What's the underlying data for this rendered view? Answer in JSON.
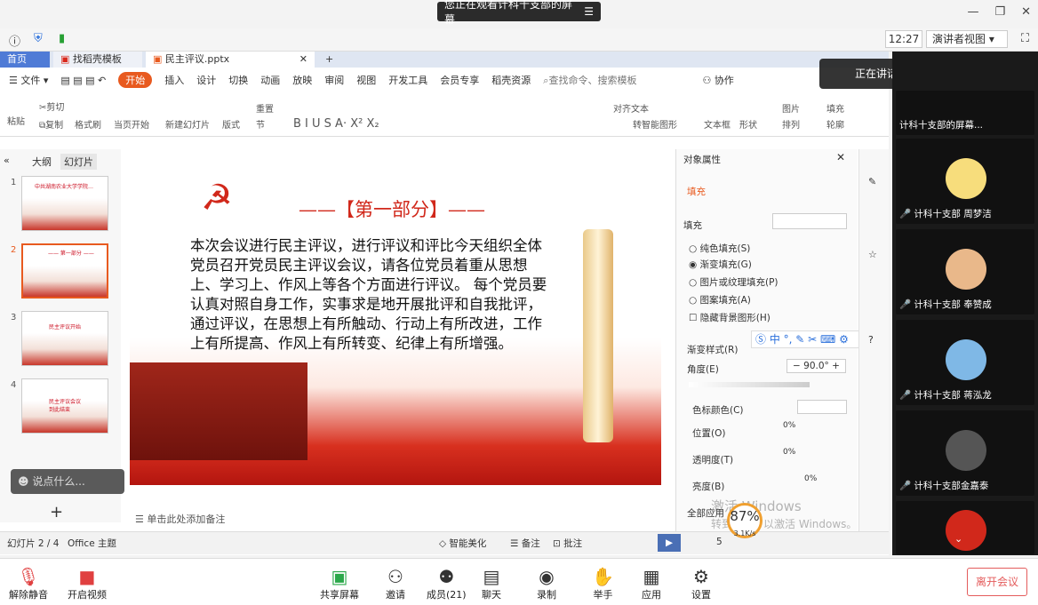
{
  "meeting": {
    "banner": "您正在观看计科十支部的屏幕",
    "clock": "12:27",
    "view_mode": "演讲者视图",
    "speaking": "正在讲话: 计科十支部;"
  },
  "wps": {
    "tabs": [
      "首页",
      "找稻壳模板",
      "民主评议.pptx"
    ],
    "menus": [
      "文件",
      "开始",
      "插入",
      "设计",
      "切换",
      "动画",
      "放映",
      "审阅",
      "视图",
      "开发工具",
      "会员专享",
      "稻壳资源"
    ],
    "search_placeholder": "查找命令、搜索模板",
    "collab": "协作",
    "ribbon": {
      "paste": "粘贴",
      "cut": "剪切",
      "copy": "复制",
      "format_painter": "格式刷",
      "start_from_current": "当页开始",
      "new_slide": "新建幻灯片",
      "layout": "版式",
      "section": "节",
      "reset": "重置",
      "align_text": "对齐文本",
      "smart_shape": "转智能图形",
      "textbox": "文本框",
      "shape": "形状",
      "picture": "图片",
      "fill": "填充",
      "arrange": "排列",
      "outline": "轮廓"
    },
    "left_tabs": [
      "大纲",
      "幻灯片"
    ],
    "slide_numbers": [
      "1",
      "2",
      "3",
      "4"
    ],
    "thumb_texts": [
      "中共湖南农业大学学院…",
      "—— 第一部分 ——",
      "民主评议开始",
      "民主评议会议 到此结束"
    ],
    "slide": {
      "title": "——【第一部分】——",
      "body": "本次会议进行民主评议，进行评议和评比今天组织全体党员召开党员民主评议会议，请各位党员着重从思想上、学习上、作风上等各个方面进行评议。 每个党员要认真对照自身工作，实事求是地开展批评和自我批评，通过评议，在思想上有所触动、行动上有所改进，工作上有所提高、作风上有所转变、纪律上有所增强。"
    },
    "props": {
      "header": "对象属性",
      "tab": "填充",
      "fill_section": "填充",
      "options": [
        "纯色填充(S)",
        "渐变填充(G)",
        "图片或纹理填充(P)",
        "图案填充(A)"
      ],
      "hide_bg": "隐藏背景图形(H)",
      "gradient_style": "渐变样式(R)",
      "angle_label": "角度(E)",
      "angle_value": "90.0°",
      "color_stop": "色标颜色(C)",
      "position": "位置(O)",
      "transparency": "透明度(T)",
      "brightness": "亮度(B)",
      "percent": "0%",
      "apply_all": "全部应用"
    },
    "notes_placeholder": "单击此处添加备注",
    "status": {
      "page": "幻灯片 2 / 4",
      "theme": "Office 主题",
      "smart": "智能美化",
      "notes": "备注",
      "comments": "批注",
      "zoom": "5"
    }
  },
  "network": {
    "percent": "87%",
    "speed": "3.1K/s"
  },
  "watermark": {
    "line1": "激活 Windows",
    "line2": "转到\"设置\"以激活 Windows。"
  },
  "chat": {
    "placeholder": "说点什么..."
  },
  "participants": [
    {
      "name": "计科十支部的屏幕..."
    },
    {
      "name": "计科十支部 周梦洁"
    },
    {
      "name": "计科十支部 奉赞成"
    },
    {
      "name": "计科十支部 蒋泓龙"
    },
    {
      "name": "计科十支部金嘉泰"
    }
  ],
  "bottom": {
    "mute": "解除静音",
    "video": "开启视频",
    "share": "共享屏幕",
    "invite": "邀请",
    "members": "成员(21)",
    "chat": "聊天",
    "record": "录制",
    "raise_hand": "举手",
    "apps": "应用",
    "settings": "设置",
    "leave": "离开会议"
  },
  "colors": {
    "accent": "#e85a1f",
    "party_red": "#d1281b",
    "leave": "#e45c5c"
  }
}
